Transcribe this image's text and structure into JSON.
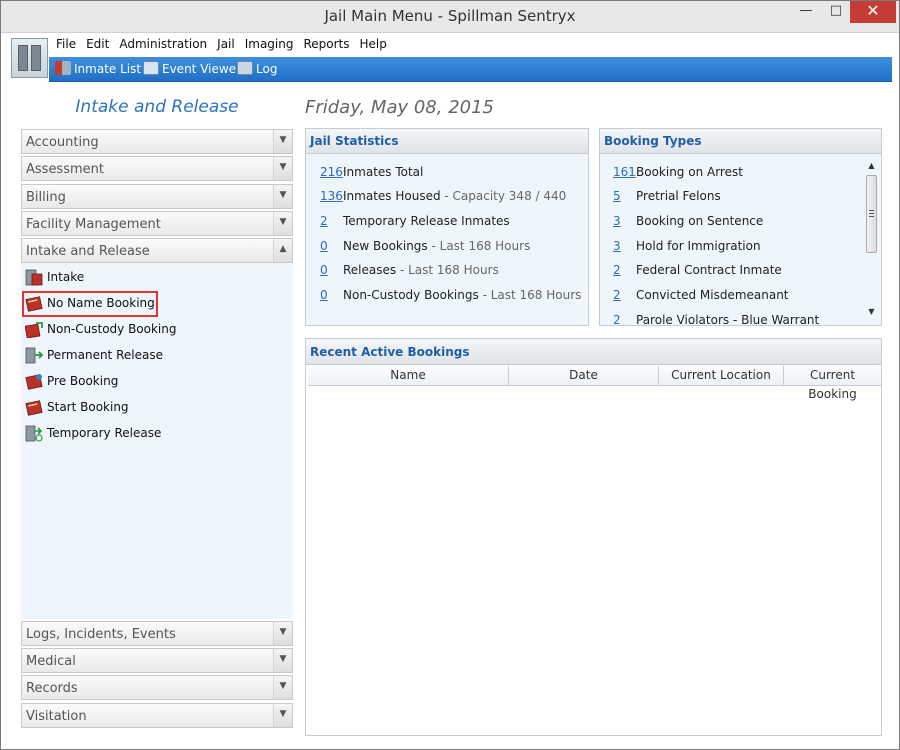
{
  "window": {
    "title": "Jail Main Menu - Spillman Sentryx"
  },
  "menu": [
    "File",
    "Edit",
    "Administration",
    "Jail",
    "Imaging",
    "Reports",
    "Help"
  ],
  "toolbar": {
    "inmate_list": "Inmate List",
    "event_viewer": "Event Viewer",
    "log": "Log"
  },
  "sidebar": {
    "title": "Intake and Release",
    "sections_top": [
      "Accounting",
      "Assessment",
      "Billing",
      "Facility Management",
      "Intake and Release"
    ],
    "items": [
      "Intake",
      "No Name Booking",
      "Non-Custody Booking",
      "Permanent Release",
      "Pre Booking",
      "Start Booking",
      "Temporary Release"
    ],
    "sections_bottom": [
      "Logs, Incidents, Events",
      "Medical",
      "Records",
      "Visitation"
    ]
  },
  "date": "Friday, May 08, 2015",
  "jail_statistics": {
    "title": "Jail Statistics",
    "rows": [
      {
        "num": "216",
        "label": "Inmates Total",
        "sub": ""
      },
      {
        "num": "136",
        "label": "Inmates Housed",
        "sub": " - Capacity 348 / 440"
      },
      {
        "num": "2",
        "label": "Temporary Release Inmates",
        "sub": ""
      },
      {
        "num": "0",
        "label": "New Bookings",
        "sub": " - Last 168 Hours"
      },
      {
        "num": "0",
        "label": "Releases",
        "sub": " - Last 168 Hours"
      },
      {
        "num": "0",
        "label": "Non-Custody Bookings",
        "sub": " - Last 168 Hours"
      }
    ]
  },
  "booking_types": {
    "title": "Booking Types",
    "rows": [
      {
        "num": "161",
        "label": "Booking on Arrest"
      },
      {
        "num": "5",
        "label": "Pretrial Felons"
      },
      {
        "num": "3",
        "label": "Booking on Sentence"
      },
      {
        "num": "3",
        "label": "Hold for Immigration"
      },
      {
        "num": "2",
        "label": "Federal Contract Inmate"
      },
      {
        "num": "2",
        "label": "Convicted Misdemeanant"
      },
      {
        "num": "2",
        "label": "Parole Violators - Blue Warrant"
      }
    ]
  },
  "recent_bookings": {
    "title": "Recent Active Bookings",
    "columns": [
      "Name",
      "Date",
      "Current Location",
      "Current Booking"
    ]
  },
  "colors": {
    "accent": "#2a71c3",
    "toolbar": "#1f6fc6",
    "highlight": "#e0382f",
    "close": "#c43c35"
  }
}
